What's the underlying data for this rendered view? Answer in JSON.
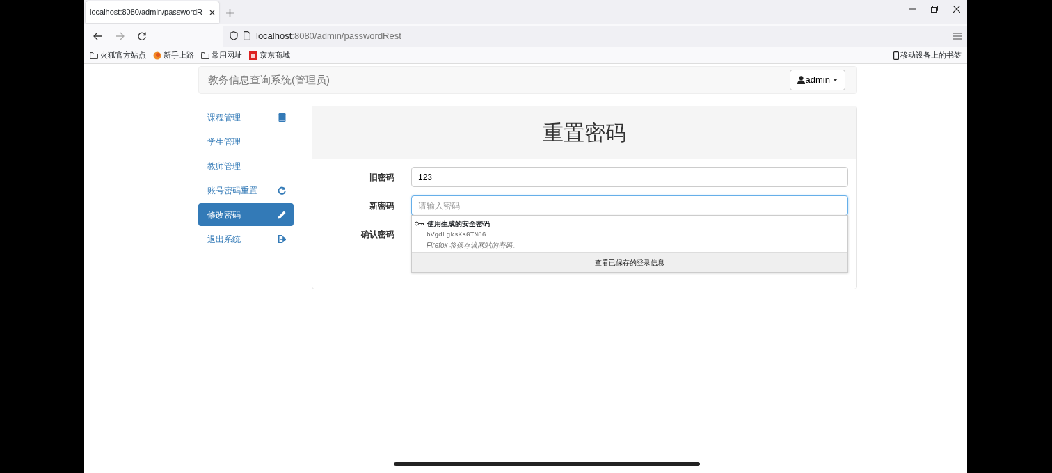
{
  "browser": {
    "tabs": [
      {
        "title": "localhost:8080/admin/passwordR",
        "selected": true
      }
    ],
    "address": {
      "host": "localhost",
      "rest": ":8080/admin/passwordRest"
    },
    "bookmarks": [
      {
        "label": "火狐官方站点",
        "kind": "folder"
      },
      {
        "label": "新手上路",
        "kind": "firefox"
      },
      {
        "label": "常用网址",
        "kind": "folder"
      },
      {
        "label": "京东商城",
        "kind": "shop"
      }
    ],
    "mobile_bookmarks": "移动设备上的书签"
  },
  "app": {
    "brand": "教务信息查询系统(管理员)",
    "user": "admin",
    "sidebar": [
      {
        "label": "课程管理",
        "kind": "book",
        "selected": false
      },
      {
        "label": "学生管理",
        "kind": "plain",
        "selected": false
      },
      {
        "label": "教师管理",
        "kind": "plain",
        "selected": false
      },
      {
        "label": "账号密码重置",
        "kind": "refresh",
        "selected": false
      },
      {
        "label": "修改密码",
        "kind": "pencil",
        "selected": true
      },
      {
        "label": "退出系统",
        "kind": "logout",
        "selected": false
      }
    ],
    "panel_title": "重置密码",
    "fields": [
      {
        "label": "旧密码",
        "value": "123",
        "focused": false
      },
      {
        "label": "新密码",
        "placeholder": "请输入密码",
        "focused": true
      },
      {
        "label": "确认密码"
      }
    ],
    "password_popup": {
      "title": "使用生成的安全密码",
      "password": "bVgdLgksKsGTN86",
      "note": "Firefox 将保存该网站的密码。",
      "footer": "查看已保存的登录信息"
    }
  }
}
